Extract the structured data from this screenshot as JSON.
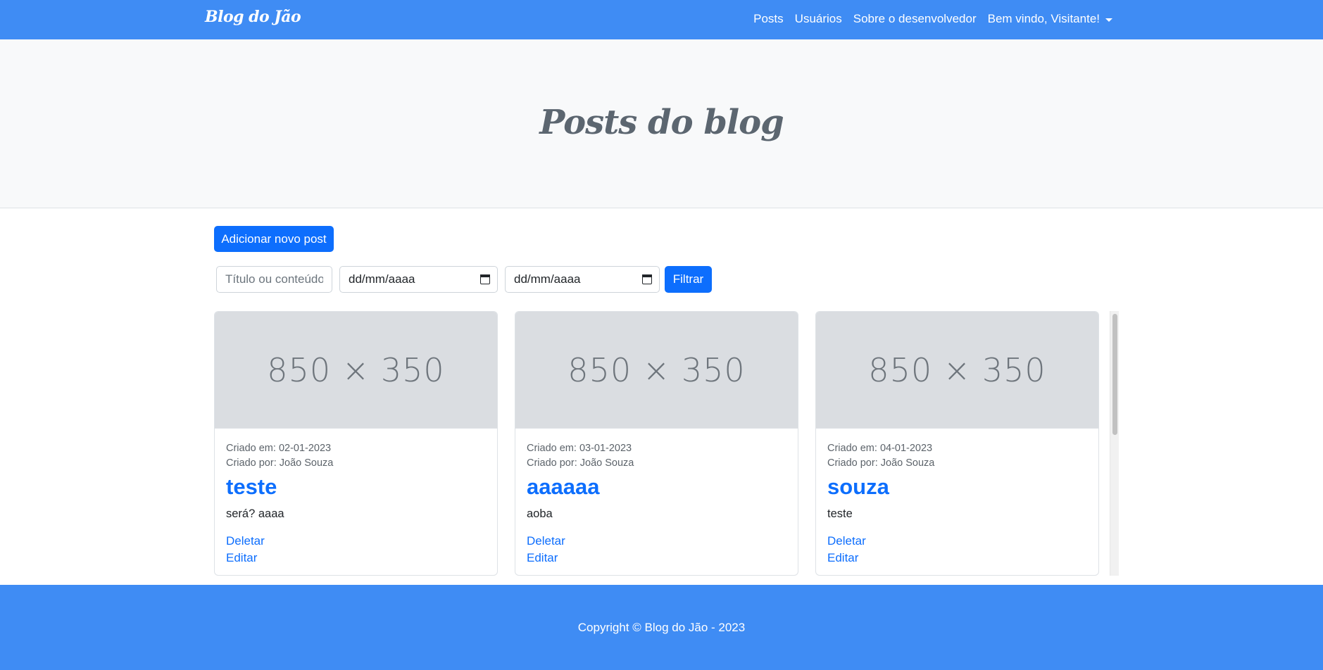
{
  "navbar": {
    "brand": "Blog do Jão",
    "links": [
      "Posts",
      "Usuários",
      "Sobre o desenvolvedor"
    ],
    "user_menu": "Bem vindo, Visitante!",
    "background_color": "#3f8cf4"
  },
  "hero": {
    "title": "Posts do blog"
  },
  "controls": {
    "add_button": "Adicionar novo post",
    "search_placeholder": "Título ou conteúdo",
    "date_from": "dd/mm/aaaa",
    "date_to": "dd/mm/aaaa",
    "filter_button": "Filtrar",
    "calendar_icon": "calendar-icon"
  },
  "posts": [
    {
      "image_text": "850 × 350",
      "created_at": "Criado em: 02-01-2023",
      "created_by": "Criado por: João Souza",
      "title": "teste",
      "content": "será? aaaa",
      "delete_label": "Deletar",
      "edit_label": "Editar"
    },
    {
      "image_text": "850 × 350",
      "created_at": "Criado em: 03-01-2023",
      "created_by": "Criado por: João Souza",
      "title": "aaaaaa",
      "content": "aoba",
      "delete_label": "Deletar",
      "edit_label": "Editar"
    },
    {
      "image_text": "850 × 350",
      "created_at": "Criado em: 04-01-2023",
      "created_by": "Criado por: João Souza",
      "title": "souza",
      "content": "teste",
      "delete_label": "Deletar",
      "edit_label": "Editar"
    }
  ],
  "footer": {
    "copyright": "Copyright © Blog do Jão - 2023"
  },
  "colors": {
    "primary": "#0d6efd",
    "hero_background": "#f8f9fa"
  }
}
